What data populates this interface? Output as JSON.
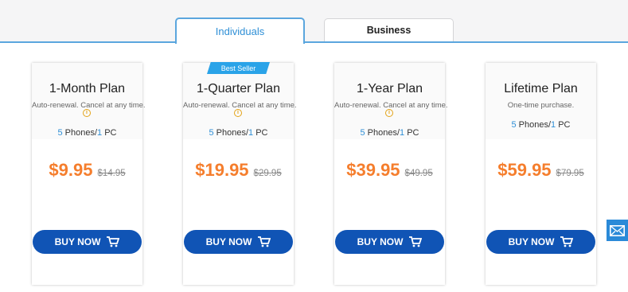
{
  "tabs": [
    {
      "label": "Individuals",
      "active": true
    },
    {
      "label": "Business",
      "active": false
    }
  ],
  "badge": {
    "label": "Best Seller"
  },
  "plans": [
    {
      "name": "1-Month Plan",
      "desc": "Auto-renewal. Cancel at any time.",
      "phones": "5",
      "phones_label": " Phones/",
      "pc": "1",
      "pc_label": " PC",
      "price": "$9.95",
      "old_price": "$14.95",
      "buy_label": "BUY NOW"
    },
    {
      "name": "1-Quarter Plan",
      "desc": "Auto-renewal. Cancel at any time.",
      "phones": "5",
      "phones_label": " Phones/",
      "pc": "1",
      "pc_label": " PC",
      "price": "$19.95",
      "old_price": "$29.95",
      "buy_label": "BUY NOW"
    },
    {
      "name": "1-Year Plan",
      "desc": "Auto-renewal. Cancel at any time.",
      "phones": "5",
      "phones_label": " Phones/",
      "pc": "1",
      "pc_label": " PC",
      "price": "$39.95",
      "old_price": "$49.95",
      "buy_label": "BUY NOW"
    },
    {
      "name": "Lifetime Plan",
      "desc": "One-time purchase.",
      "phones": "5",
      "phones_label": " Phones/",
      "pc": "1",
      "pc_label": " PC",
      "price": "$59.95",
      "old_price": "$79.95",
      "buy_label": "BUY NOW"
    }
  ],
  "icons": {
    "info": "info-icon",
    "cart": "cart-icon",
    "mail": "mail-icon"
  },
  "colors": {
    "accent": "#1054b5",
    "price": "#f57e2d",
    "badge": "#2aa3e8",
    "tab_active": "#2f8fd6"
  }
}
